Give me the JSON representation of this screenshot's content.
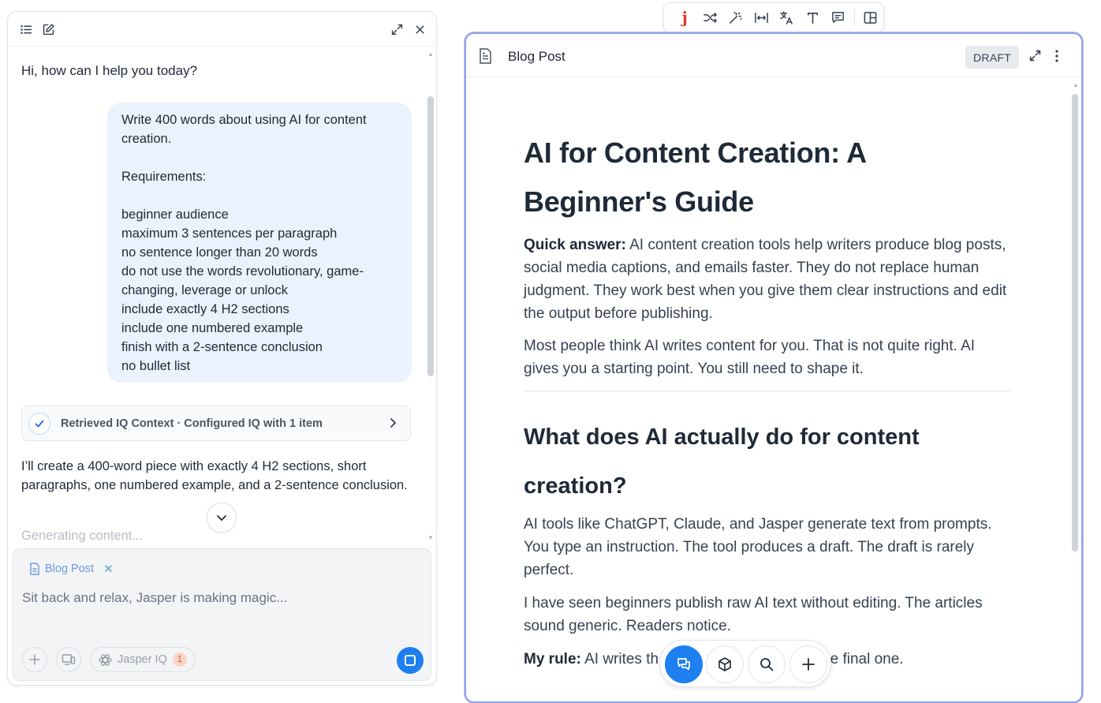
{
  "chat": {
    "greeting": "Hi, how can I help you today?",
    "user_message": "Write 400 words about using AI for content creation.\n\nRequirements:\n\nbeginner audience\nmaximum 3 sentences per paragraph\nno sentence longer than 20 words\ndo not use the words revolutionary, game-changing, leverage or unlock\ninclude exactly 4 H2 sections\ninclude one numbered example\nfinish with a 2-sentence conclusion\nno bullet list",
    "context_card": "Retrieved IQ Context · Configured IQ with 1 item",
    "assistant_reply": "I’ll create a 400-word piece with exactly 4 H2 sections, short paragraphs, one numbered example, and a 2-sentence conclusion.",
    "status": "Generating content...",
    "icons": {
      "list": "list-icon",
      "new_chat": "edit-icon",
      "expand": "expand-icon",
      "close": "close-icon",
      "scroll_down": "chevron-down-icon"
    }
  },
  "composer": {
    "attachment": "Blog Post",
    "placeholder": "Sit back and relax, Jasper is making magic...",
    "iq_label": "Jasper IQ",
    "iq_count": "1"
  },
  "toolbar": {
    "brand_glyph": "j",
    "items": [
      "shuffle-icon",
      "magic-wand-icon",
      "width-icon",
      "translate-icon",
      "text-icon",
      "comment-icon",
      "layout-icon"
    ]
  },
  "doc": {
    "title": "Blog Post",
    "status": "DRAFT",
    "h1": "AI for Content Creation: A Beginner's Guide",
    "p1_bold": "Quick answer:",
    "p1": " AI content creation tools help writers produce blog posts, social media captions, and emails faster. They do not replace human judgment. They work best when you give them clear instructions and edit the output before publishing.",
    "p2": "Most people think AI writes content for you. That is not quite right. AI gives you a starting point. You still need to shape it.",
    "h2": "What does AI actually do for content creation?",
    "p3": "AI tools like ChatGPT, Claude, and Jasper generate text from prompts. You type an instruction. The tool produces a draft. The draft is rarely perfect.",
    "p4": "I have seen beginners publish raw AI text without editing. The articles sound generic. Readers notice.",
    "p5_bold": "My rule:",
    "p5_start": " AI writes th",
    "p5_end": "he final one."
  },
  "colors": {
    "accent": "#1d7ff0",
    "user_bubble": "#eaf2fd",
    "brand_red": "#e5372c",
    "panel_border": "#8aa3ea"
  }
}
